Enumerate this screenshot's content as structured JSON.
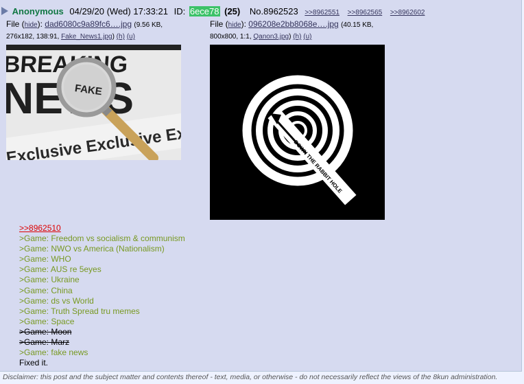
{
  "post": {
    "name": "Anonymous",
    "datetime": "04/29/20 (Wed) 17:33:21",
    "id_label": "ID:",
    "id_value": "6ece78",
    "id_color": "#3cc268",
    "reply_count": "(25)",
    "post_number": "No.8962523",
    "backlinks": [
      ">>8962551",
      ">>8962565",
      ">>8962602"
    ]
  },
  "files": [
    {
      "file_label": "File (",
      "hide_label": "hide",
      "after_hide": "):",
      "filename": "dad6080c9a89fc6….jpg",
      "size_info": "(9.56 KB,",
      "dims": "276x182, 138:91,",
      "original_name": "Fake_News1.jpg",
      "h_link": "(h)",
      "u_link": "(u)",
      "thumb_description": "Breaking News / Exclusive newspaper with a magnifying glass over the word FAKE",
      "thumb_word_1": "BREAKING",
      "thumb_word_2": "NEWS",
      "thumb_word_3": "FAKE",
      "thumb_word_4": "Exclusive Exclusive Excl"
    },
    {
      "file_label": "File (",
      "hide_label": "hide",
      "after_hide": "):",
      "filename": "096208e2bb8068e….jpg",
      "size_info": "(40.15 KB,",
      "dims": "800x800, 1:1,",
      "original_name": "Qanon3.jpg",
      "h_link": "(h)",
      "u_link": "(u)",
      "thumb_description": "Black square with white Q spiral, text DOWN THE RABBIT HOLE",
      "thumb_text": "DOWN THE RABBIT HOLE"
    }
  ],
  "body": {
    "reply_link": ">>8962510",
    "lines": [
      {
        "text": ">Game: Freedom vs socialism & communism",
        "style": "green"
      },
      {
        "text": ">Game: NWO vs America (Nationalism)",
        "style": "green"
      },
      {
        "text": ">Game: WHO",
        "style": "green"
      },
      {
        "text": ">Game: AUS re 5eyes",
        "style": "green"
      },
      {
        "text": ">Game: Ukraine",
        "style": "green"
      },
      {
        "text": ">Game: China",
        "style": "green"
      },
      {
        "text": ">Game: ds vs World",
        "style": "green"
      },
      {
        "text": ">Game: Truth Spread tru memes",
        "style": "green"
      },
      {
        "text": ">Game: Space",
        "style": "green"
      },
      {
        "text": ">Game: Moon",
        "style": "strike"
      },
      {
        "text": ">Game: Marz",
        "style": "strike"
      },
      {
        "text": ">Game: fake news",
        "style": "green"
      },
      {
        "text": "Fixed it.",
        "style": "plain"
      }
    ]
  },
  "disclaimer": "Disclaimer: this post and the subject matter and contents thereof - text, media, or otherwise - do not necessarily reflect the views of the 8kun administration."
}
